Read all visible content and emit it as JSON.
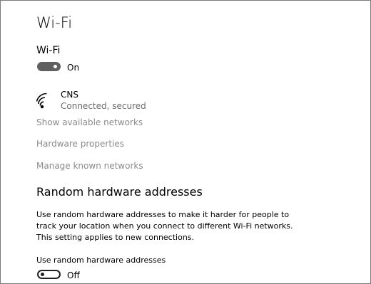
{
  "page": {
    "title": "Wi-Fi"
  },
  "wifi": {
    "section_label": "Wi-Fi",
    "toggle_state": "On",
    "toggle_on": true
  },
  "network": {
    "icon": "wifi-signal-icon",
    "name": "CNS",
    "status": "Connected, secured"
  },
  "links": {
    "show_available": "Show available networks",
    "hardware_properties": "Hardware properties",
    "manage_known": "Manage known networks"
  },
  "random_hw": {
    "heading": "Random hardware addresses",
    "description_lines": [
      "Use random hardware addresses to make it harder for people to",
      "track your location when you connect to different Wi-Fi networks.",
      "This setting applies to new connections."
    ],
    "option_label": "Use random hardware addresses",
    "toggle_state": "Off",
    "toggle_on": false
  },
  "colors": {
    "toggle_on_fill": "#606060",
    "link_text": "#8a8a8a",
    "secondary_text": "#6b6b6b"
  }
}
